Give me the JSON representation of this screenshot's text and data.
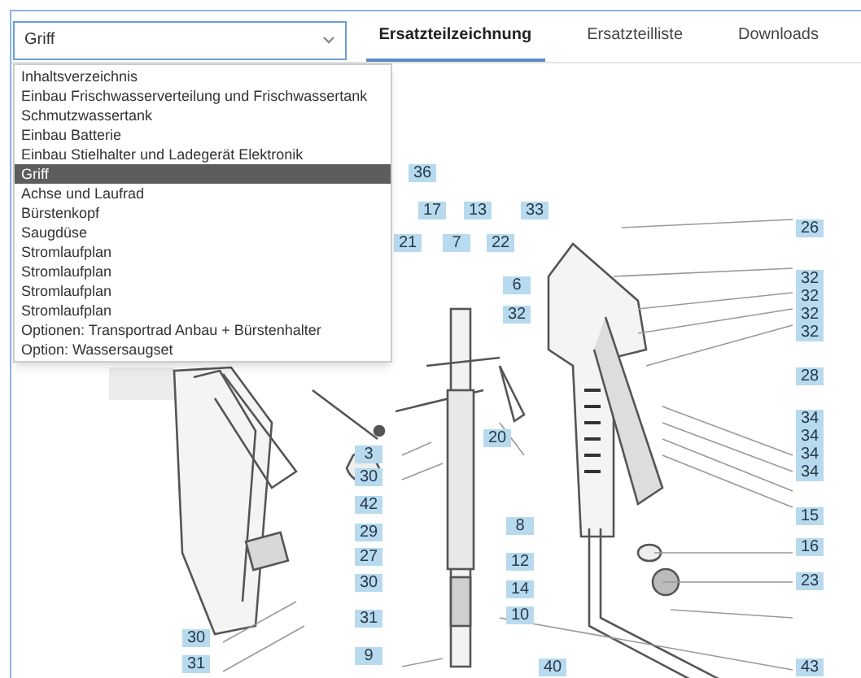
{
  "select": {
    "value": "Griff"
  },
  "tabs": [
    {
      "label": "Ersatzteilzeichnung",
      "selected": true
    },
    {
      "label": "Ersatzteilliste",
      "selected": false
    },
    {
      "label": "Downloads",
      "selected": false
    }
  ],
  "dropdown": {
    "items": [
      {
        "label": "Inhaltsverzeichnis",
        "selected": false
      },
      {
        "label": "Einbau Frischwasserverteilung und Frischwassertank",
        "selected": false
      },
      {
        "label": "Schmutzwassertank",
        "selected": false
      },
      {
        "label": "Einbau Batterie",
        "selected": false
      },
      {
        "label": "Einbau Stielhalter und Ladegerät Elektronik",
        "selected": false
      },
      {
        "label": "Griff",
        "selected": true
      },
      {
        "label": "Achse und Laufrad",
        "selected": false
      },
      {
        "label": "Bürstenkopf",
        "selected": false
      },
      {
        "label": "Saugdüse",
        "selected": false
      },
      {
        "label": "Stromlaufplan",
        "selected": false
      },
      {
        "label": "Stromlaufplan",
        "selected": false
      },
      {
        "label": "Stromlaufplan",
        "selected": false
      },
      {
        "label": "Stromlaufplan",
        "selected": false
      },
      {
        "label": "Optionen: Transportrad Anbau + Bürstenhalter",
        "selected": false
      },
      {
        "label": "Option: Wassersaugset",
        "selected": false
      }
    ]
  },
  "diagram": {
    "callouts": [
      "36",
      "17",
      "13",
      "33",
      "21",
      "7",
      "22",
      "26",
      "6",
      "32",
      "32",
      "32",
      "32",
      "32",
      "28",
      "34",
      "34",
      "34",
      "34",
      "20",
      "3",
      "30",
      "42",
      "29",
      "27",
      "30",
      "8",
      "15",
      "16",
      "12",
      "23",
      "14",
      "31",
      "10",
      "30",
      "9",
      "31",
      "40",
      "43"
    ]
  }
}
